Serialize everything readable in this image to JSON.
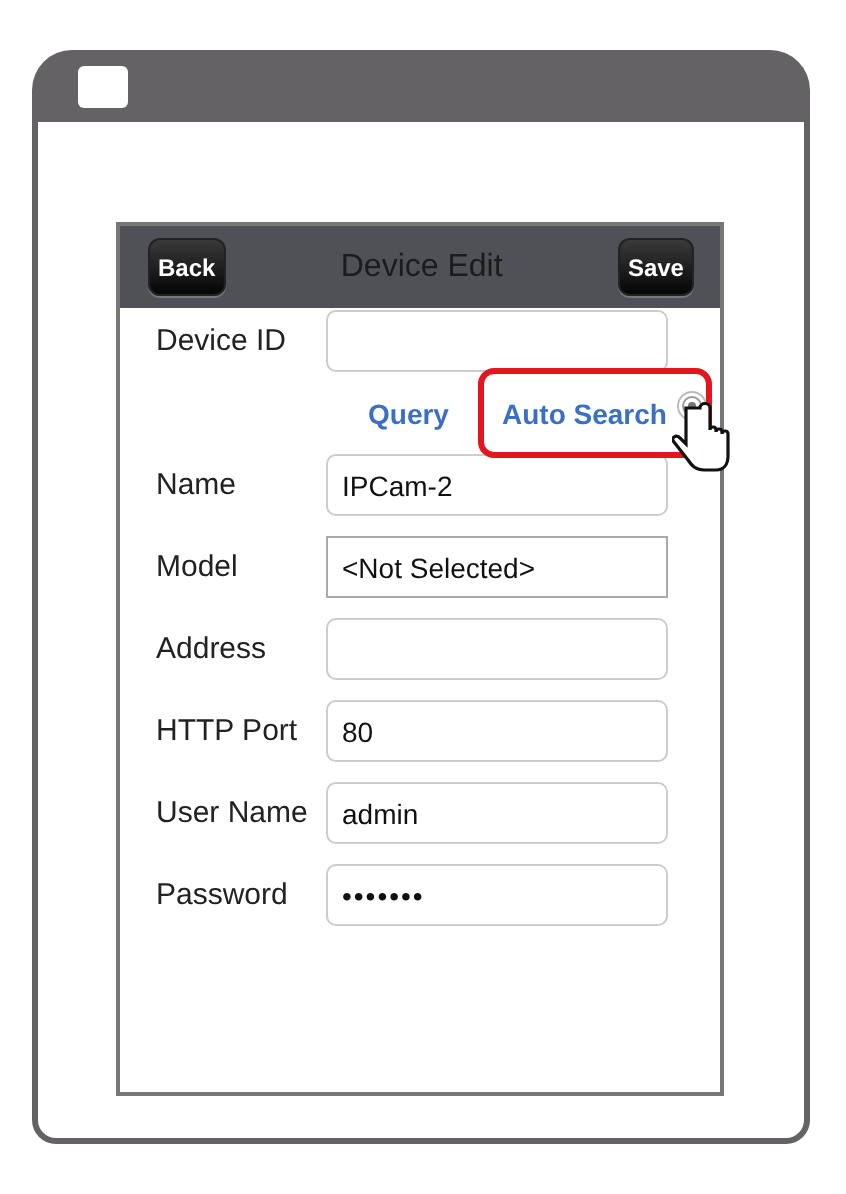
{
  "screen": {
    "title": "Device Edit",
    "back_button": "Back",
    "save_button": "Save"
  },
  "actions": [
    {
      "label": "Query",
      "highlighted": false
    },
    {
      "label": "Auto Search",
      "highlighted": true
    }
  ],
  "fields": [
    {
      "label": "Device ID",
      "kind": "text"
    },
    {
      "label": "Name",
      "kind": "text",
      "value": "IPCam-2"
    },
    {
      "label": "Model",
      "kind": "select",
      "value": "<Not Selected>"
    },
    {
      "label": "Address",
      "kind": "text"
    },
    {
      "label": "HTTP Port",
      "kind": "text",
      "value": "80"
    },
    {
      "label": "User Name",
      "kind": "text",
      "value": "admin"
    },
    {
      "label": "Password",
      "kind": "password",
      "value": "•••••••"
    }
  ]
}
